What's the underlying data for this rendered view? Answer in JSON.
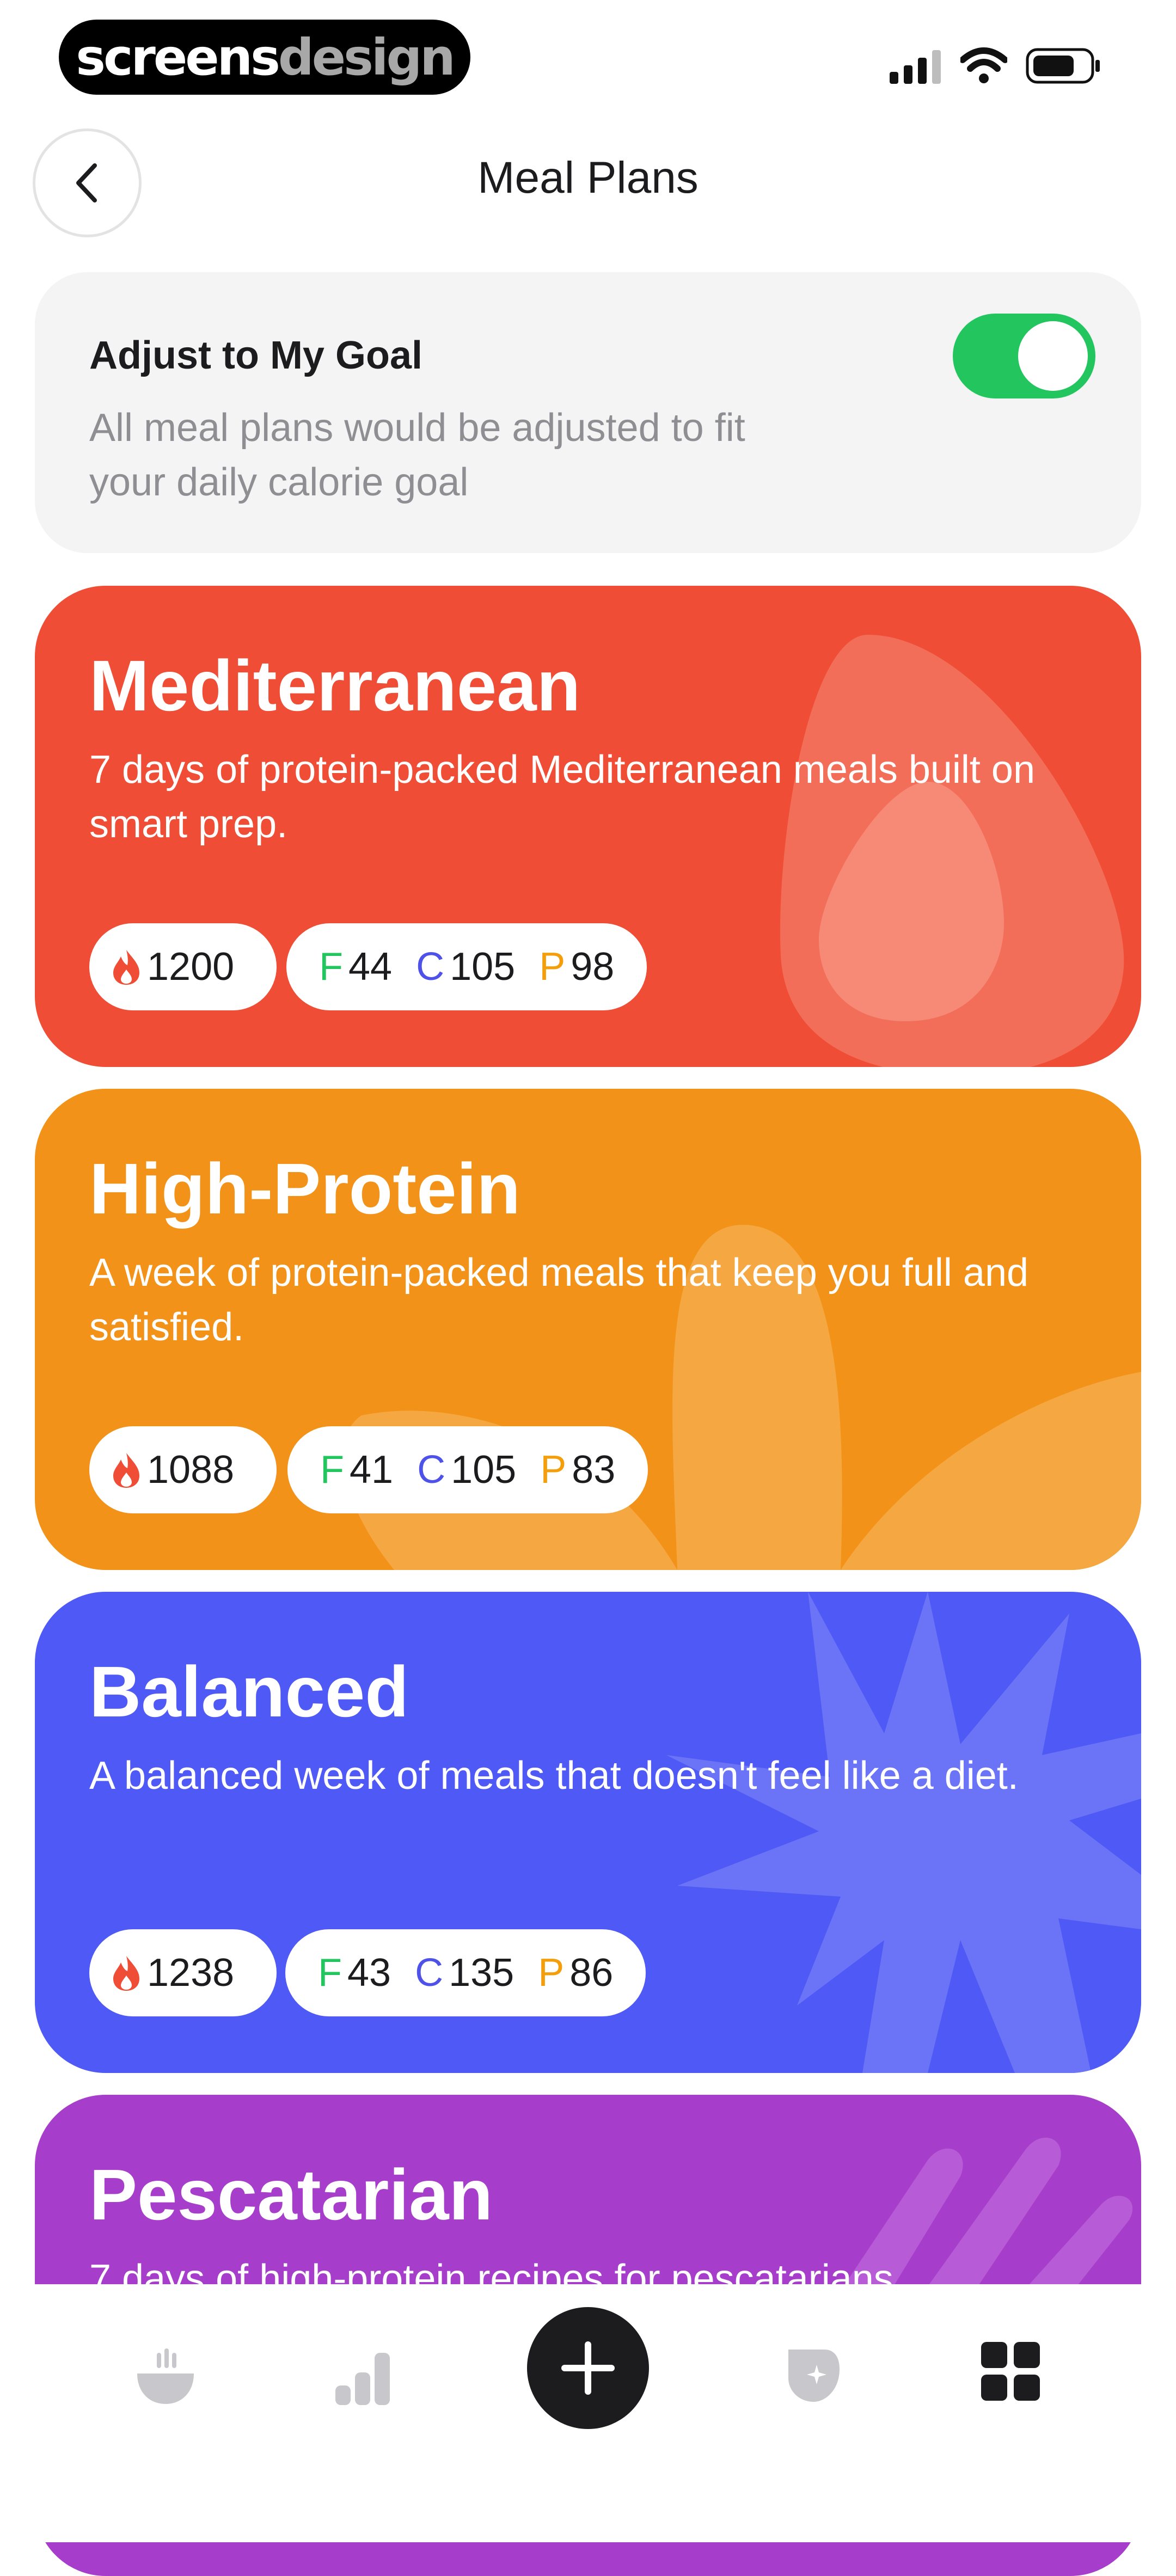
{
  "status_bar": {
    "brand_part1": "screens",
    "brand_part2": "design"
  },
  "header": {
    "title": "Meal Plans",
    "back_icon": "chevron-left-icon"
  },
  "goal_card": {
    "title": "Adjust to My Goal",
    "description": "All meal plans would be adjusted to fit your daily calorie goal",
    "toggle_on": true,
    "toggle_color": "#22c55e"
  },
  "plans": [
    {
      "title": "Mediterranean",
      "description": "7 days of protein-packed Mediterranean meals built on smart prep.",
      "calories": "1200",
      "f_label": "F",
      "f_value": "44",
      "c_label": "C",
      "c_value": "105",
      "p_label": "P",
      "p_value": "98",
      "color": "#ef4d35"
    },
    {
      "title": "High-Protein",
      "description": "A week of protein-packed meals that keep you full and satisfied.",
      "calories": "1088",
      "f_label": "F",
      "f_value": "41",
      "c_label": "C",
      "c_value": "105",
      "p_label": "P",
      "p_value": "83",
      "color": "#f39219"
    },
    {
      "title": "Balanced",
      "description": "A balanced week of meals that doesn't feel like a diet.",
      "calories": "1238",
      "f_label": "F",
      "f_value": "43",
      "c_label": "C",
      "c_value": "135",
      "p_label": "P",
      "p_value": "86",
      "color": "#4f59f5"
    },
    {
      "title": "Pescatarian",
      "description": "7 days of high-protein recipes for pescatarians",
      "color": "#a63ecb"
    }
  ],
  "bottom_nav": {
    "items": [
      "bowl-icon",
      "bar-chart-icon",
      "plus-icon",
      "badge-icon",
      "grid-icon"
    ]
  }
}
